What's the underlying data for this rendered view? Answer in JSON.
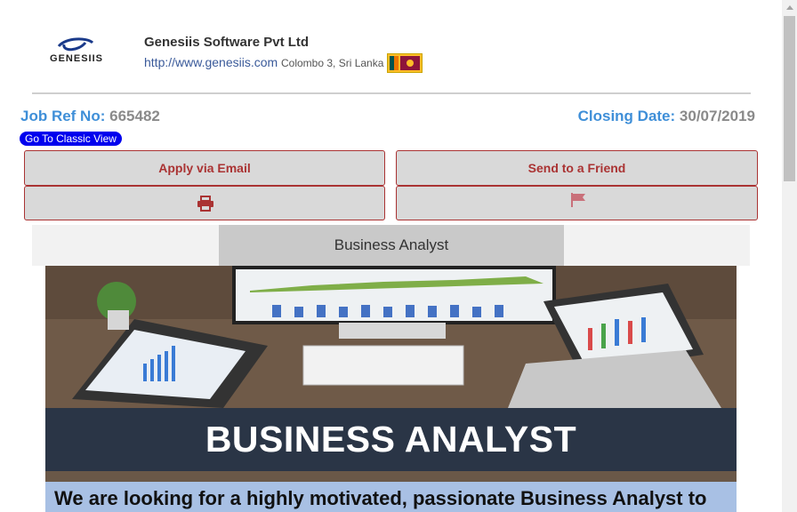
{
  "company": {
    "name": "Genesiis Software Pvt Ltd",
    "url": "http://www.genesiis.com",
    "location": "Colombo 3, Sri Lanka",
    "logo_text": "GENESIIS"
  },
  "job": {
    "ref_label": "Job Ref No:",
    "ref_value": "665482",
    "closing_label": "Closing Date:",
    "closing_value": "30/07/2019",
    "classic_view": "Go To Classic View"
  },
  "actions": {
    "apply_email": "Apply via Email",
    "send_friend": "Send to a Friend"
  },
  "title": "Business Analyst",
  "banner": {
    "headline": "BUSINESS ANALYST",
    "subtext": "We are looking for a highly motivated, passionate Business Analyst to"
  },
  "colors": {
    "accent_blue": "#3f8fd8",
    "button_red": "#a33",
    "classic_blue": "#0000ee"
  }
}
